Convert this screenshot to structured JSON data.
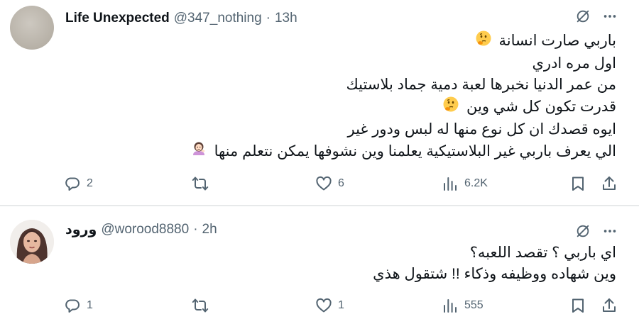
{
  "tweets": [
    {
      "display_name": "Life Unexpected",
      "handle": "@347_nothing",
      "separator": "·",
      "time": "13h",
      "lines": [
        "باربي صارت انسانة",
        "اول مره ادري",
        "من عمر الدنيا نخبرها لعبة دمية جماد بلاستيك",
        "قدرت تكون كل شي وين",
        "ايوه قصدك ان كل نوع منها له لبس ودور غير",
        "الي يعرف باربي غير البلاستيكية يعلمنا وين نشوفها يمكن نتعلم منها"
      ],
      "emojis": [
        "thinking-face",
        "thinking-face",
        "woman-tipping-hand"
      ],
      "stats": {
        "replies": "2",
        "retweets": "",
        "likes": "6",
        "views": "6.2K"
      }
    },
    {
      "display_name": "ورود",
      "handle": "@worood8880",
      "separator": "·",
      "time": "2h",
      "lines": [
        "اي باربي ؟ تقصد اللعبه؟",
        "وين شهاده ووظيفه وذكاء !! شتقول هذي"
      ],
      "stats": {
        "replies": "1",
        "retweets": "",
        "likes": "1",
        "views": "555"
      }
    }
  ],
  "colors": {
    "text": "#0f1419",
    "secondary": "#536471",
    "divider": "#e7e9ea",
    "background": "#ffffff"
  },
  "icons": [
    "grok-icon",
    "more-icon",
    "reply-icon",
    "retweet-icon",
    "like-icon",
    "views-icon",
    "bookmark-icon",
    "share-icon"
  ]
}
